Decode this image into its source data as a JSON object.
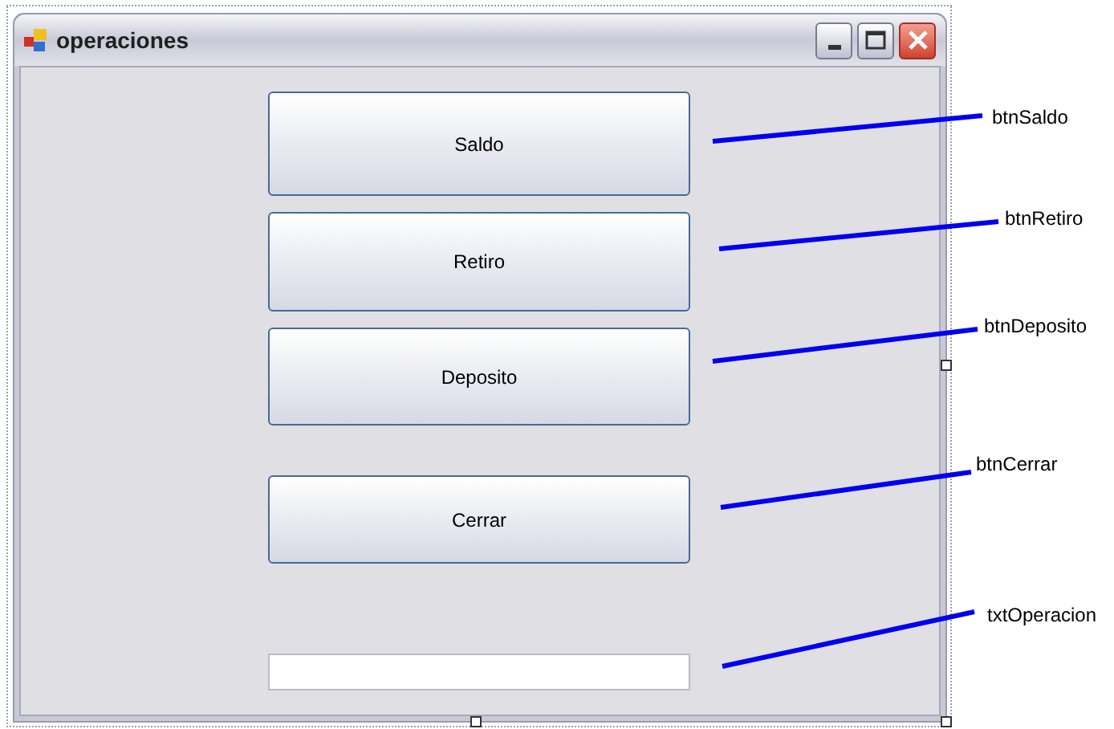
{
  "window": {
    "title": "operaciones"
  },
  "controls": [
    {
      "kind": "button",
      "text": "Saldo"
    },
    {
      "kind": "button",
      "text": "Retiro"
    },
    {
      "kind": "button",
      "text": "Deposito"
    },
    {
      "kind": "button",
      "text": "Cerrar"
    },
    {
      "kind": "textbox"
    }
  ],
  "annotations": [
    {
      "label": "btnSaldo"
    },
    {
      "label": "btnRetiro"
    },
    {
      "label": "btnDeposito"
    },
    {
      "label": "btnCerrar"
    },
    {
      "label": "txtOperacion"
    }
  ]
}
